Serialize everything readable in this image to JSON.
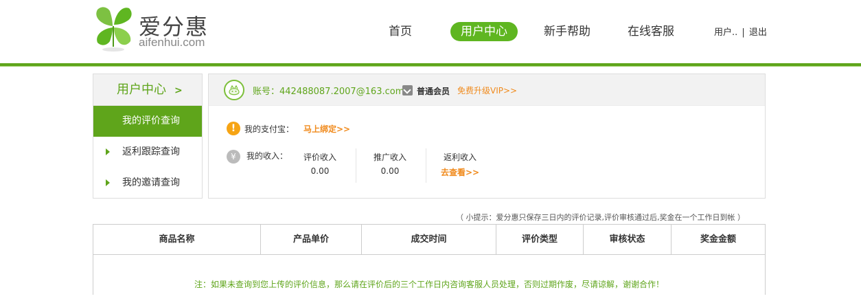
{
  "brand": {
    "name_cn": "爱分惠",
    "name_en": "aifenhui.com",
    "green": "#5fa51b",
    "orange": "#f08a1c"
  },
  "nav": {
    "items": [
      {
        "label": "首页"
      },
      {
        "label": "用户中心",
        "active": true
      },
      {
        "label": "新手帮助"
      },
      {
        "label": "在线客服"
      }
    ],
    "user": "用户..",
    "separator": "|",
    "logout": "退出"
  },
  "sidebar": {
    "title": "用户中心",
    "items": [
      {
        "label": "我的评价查询",
        "active": true
      },
      {
        "label": "返利跟踪查询"
      },
      {
        "label": "我的邀请查询"
      }
    ]
  },
  "account": {
    "label": "账号：442488087.2007@163.com",
    "member_type": "普通会员",
    "upgrade": "免费升级VIP>>",
    "alipay_label": "我的支付宝：",
    "alipay_link": "马上绑定>>",
    "income_label": "我的收入：",
    "income_icon": "¥",
    "alipay_icon": "!",
    "incomes": [
      {
        "title": "评价收入",
        "value": "0.00"
      },
      {
        "title": "推广收入",
        "value": "0.00"
      },
      {
        "title": "返利收入",
        "value": "去查看>>"
      }
    ]
  },
  "tip": "（ 小提示：爱分惠只保存三日内的评价记录,评价审核通过后,奖金在一个工作日到帐 ）",
  "table": {
    "headers": [
      "商品名称",
      "产品单价",
      "成交时间",
      "评价类型",
      "审核状态",
      "奖金金额"
    ],
    "note": "注：如果未查询到您上传的评价信息，那么请在评价后的三个工作日内咨询客服人员处理，否则过期作废，尽请谅解，谢谢合作！"
  }
}
